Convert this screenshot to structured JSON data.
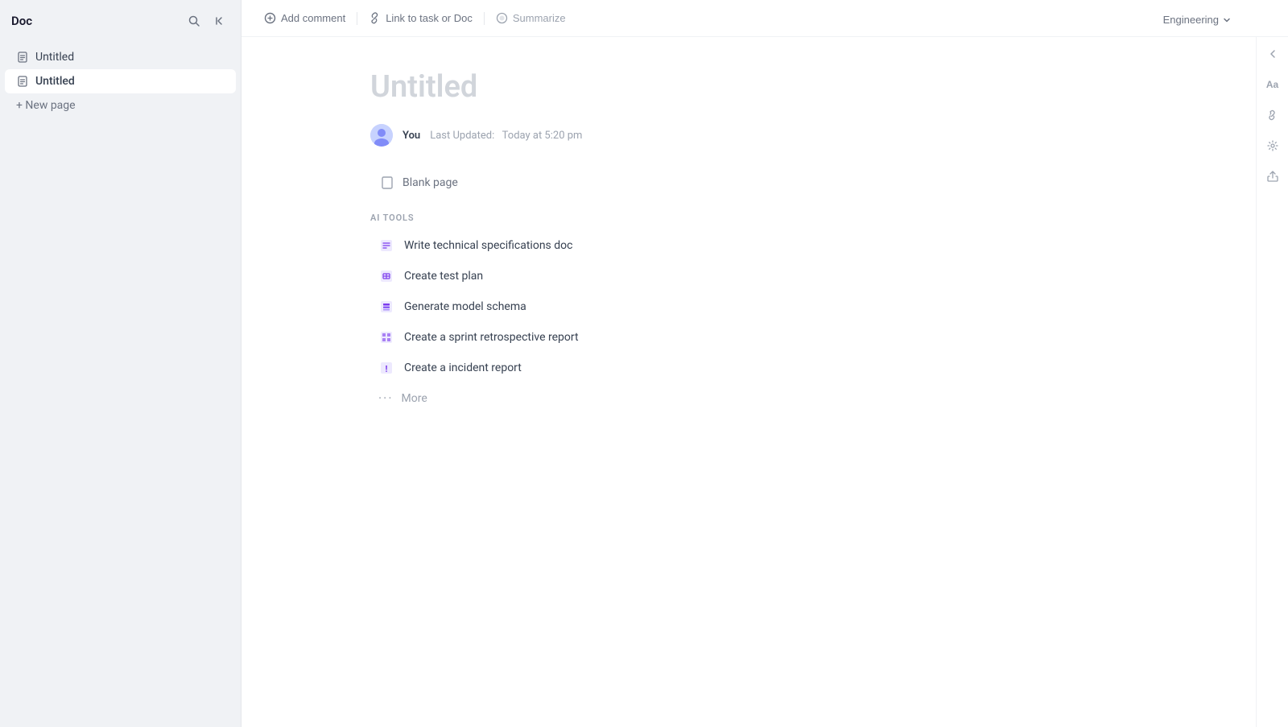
{
  "sidebar": {
    "title": "Doc",
    "items": [
      {
        "id": "untitled-1",
        "label": "Untitled",
        "active": false
      },
      {
        "id": "untitled-2",
        "label": "Untitled",
        "active": true
      }
    ],
    "new_page_label": "+ New page"
  },
  "toolbar": {
    "add_comment_label": "Add comment",
    "link_label": "Link to task or Doc",
    "summarize_label": "Summarize"
  },
  "document": {
    "title": "Untitled",
    "author": "You",
    "last_updated_label": "Last Updated:",
    "last_updated_value": "Today at 5:20 pm"
  },
  "content": {
    "blank_page_label": "Blank page",
    "ai_tools_section_label": "AI TOOLS",
    "ai_tools": [
      {
        "id": "write-tech-spec",
        "label": "Write technical specifications doc",
        "icon": "doc-icon"
      },
      {
        "id": "create-test-plan",
        "label": "Create test plan",
        "icon": "table-icon"
      },
      {
        "id": "generate-model-schema",
        "label": "Generate model schema",
        "icon": "stack-icon"
      },
      {
        "id": "sprint-retro",
        "label": "Create a sprint retrospective report",
        "icon": "doc-grid-icon"
      },
      {
        "id": "incident-report",
        "label": "Create a incident report",
        "icon": "alert-icon"
      }
    ],
    "more_label": "More"
  },
  "engineering_dropdown": {
    "label": "Engineering"
  },
  "right_sidebar": {
    "collapse_label": "←",
    "font_label": "Aa",
    "link_icon_label": "link",
    "settings_label": "settings",
    "share_label": "share"
  }
}
